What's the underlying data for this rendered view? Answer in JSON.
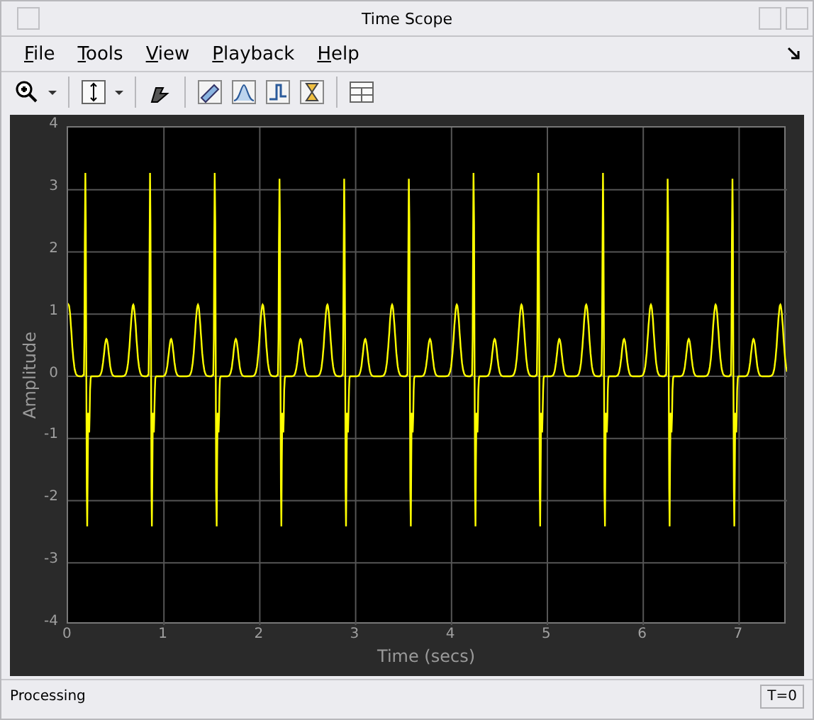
{
  "window": {
    "title": "Time Scope"
  },
  "menu": [
    {
      "label": "File"
    },
    {
      "label": "Tools"
    },
    {
      "label": "View"
    },
    {
      "label": "Playback"
    },
    {
      "label": "Help"
    }
  ],
  "toolbar": [
    {
      "kind": "zoom"
    },
    {
      "kind": "dropdown"
    },
    {
      "kind": "sep"
    },
    {
      "kind": "scale"
    },
    {
      "kind": "dropdown"
    },
    {
      "kind": "sep"
    },
    {
      "kind": "highlight"
    },
    {
      "kind": "sep"
    },
    {
      "kind": "ruler"
    },
    {
      "kind": "peak"
    },
    {
      "kind": "step"
    },
    {
      "kind": "hourglass"
    },
    {
      "kind": "sep"
    },
    {
      "kind": "layout"
    }
  ],
  "plot": {
    "xlabel": "Time (secs)",
    "ylabel": "Amplitude",
    "xticks": [
      "0",
      "1",
      "2",
      "3",
      "4",
      "5",
      "6",
      "7"
    ],
    "yticks": [
      "4",
      "3",
      "2",
      "1",
      "0",
      "-1",
      "-2",
      "-3",
      "-4"
    ]
  },
  "status_bar": {
    "message": "Processing",
    "time": "T=0"
  }
}
